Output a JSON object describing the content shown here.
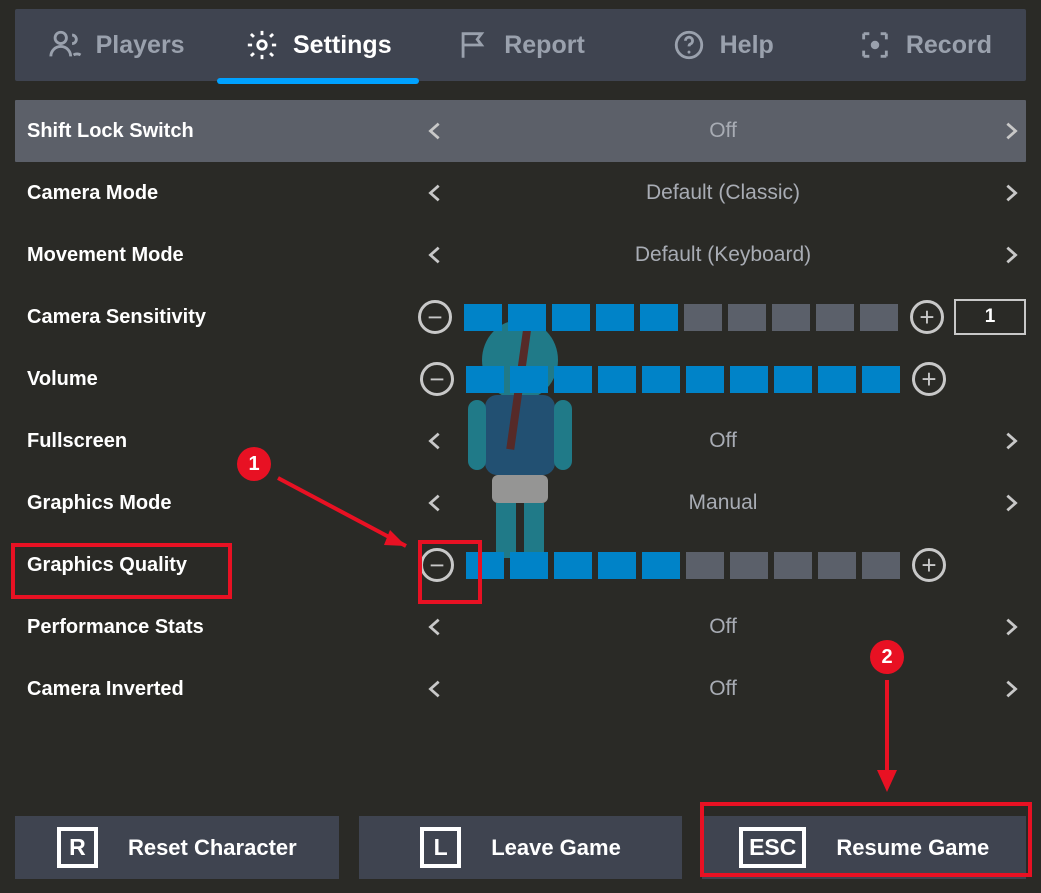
{
  "tabs": [
    {
      "label": "Players"
    },
    {
      "label": "Settings",
      "active": true
    },
    {
      "label": "Report"
    },
    {
      "label": "Help"
    },
    {
      "label": "Record"
    }
  ],
  "rows": [
    {
      "key": "shift_lock",
      "label": "Shift Lock Switch",
      "type": "choice",
      "value": "Off",
      "hl": true
    },
    {
      "key": "camera_mode",
      "label": "Camera Mode",
      "type": "choice",
      "value": "Default (Classic)"
    },
    {
      "key": "movement_mode",
      "label": "Movement Mode",
      "type": "choice",
      "value": "Default (Keyboard)"
    },
    {
      "key": "camera_sens",
      "label": "Camera Sensitivity",
      "type": "slider",
      "fill": 5,
      "total": 10,
      "num": "1"
    },
    {
      "key": "volume",
      "label": "Volume",
      "type": "slider",
      "fill": 10,
      "total": 10
    },
    {
      "key": "fullscreen",
      "label": "Fullscreen",
      "type": "choice",
      "value": "Off"
    },
    {
      "key": "graphics_mode",
      "label": "Graphics Mode",
      "type": "choice",
      "value": "Manual"
    },
    {
      "key": "graphics_quality",
      "label": "Graphics Quality",
      "type": "slider",
      "fill": 5,
      "total": 10
    },
    {
      "key": "perf_stats",
      "label": "Performance Stats",
      "type": "choice",
      "value": "Off"
    },
    {
      "key": "camera_inverted",
      "label": "Camera Inverted",
      "type": "choice",
      "value": "Off"
    }
  ],
  "buttons": [
    {
      "key": "reset",
      "hotkey": "R",
      "label": "Reset Character"
    },
    {
      "key": "leave",
      "hotkey": "L",
      "label": "Leave Game"
    },
    {
      "key": "resume",
      "hotkey": "ESC",
      "label": "Resume Game"
    }
  ],
  "annotations": {
    "callout1": "1",
    "callout2": "2"
  }
}
